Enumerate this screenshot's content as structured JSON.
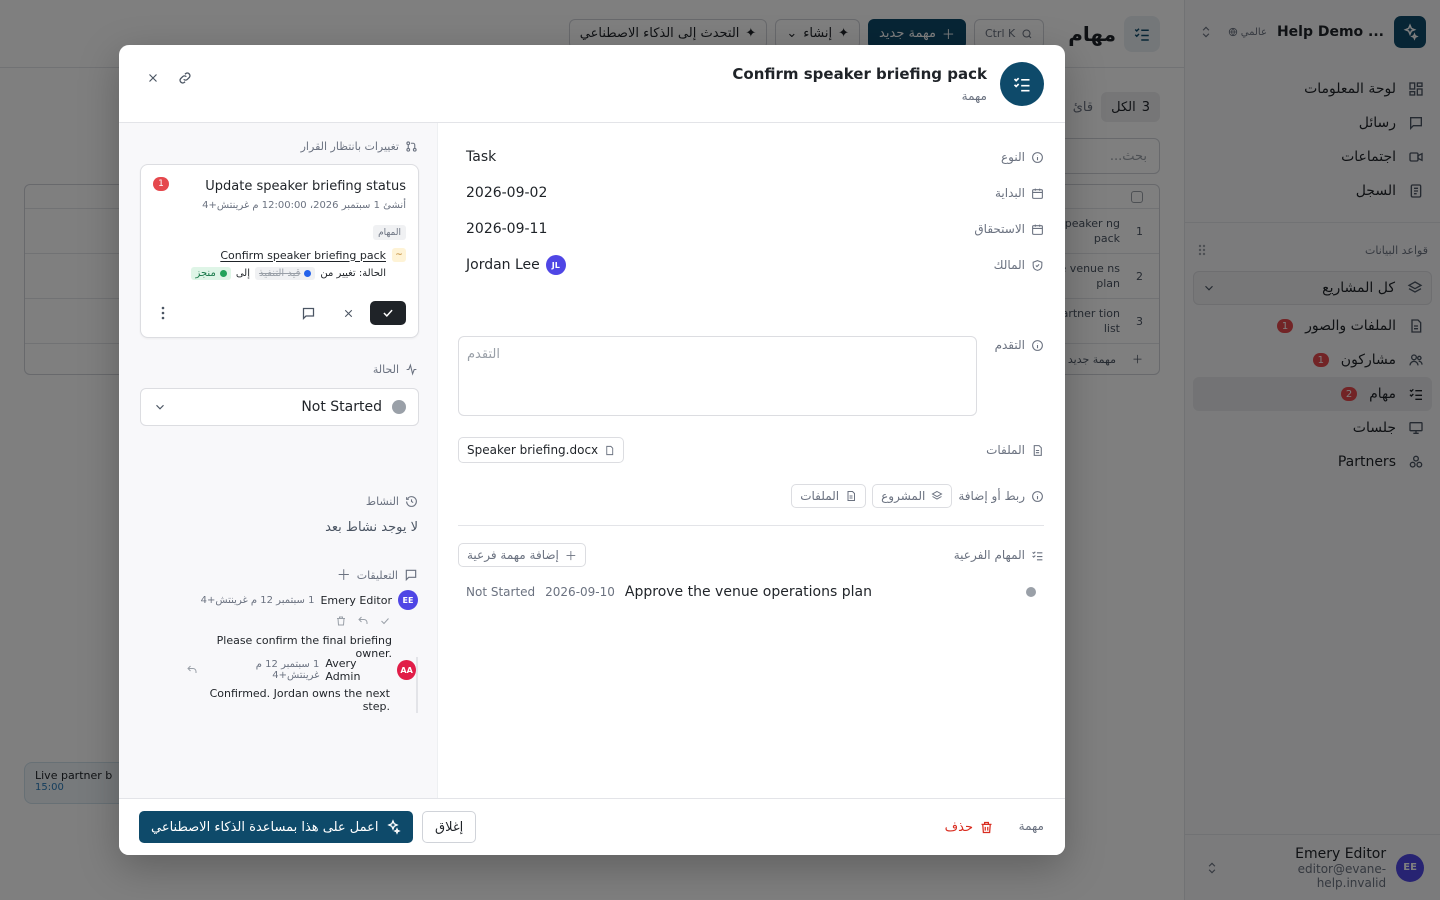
{
  "colors": {
    "brand": "#0e4a6a",
    "danger": "#d92d20",
    "badge": "#e5484d",
    "success": "#19794a",
    "avatar": "#4f46e5"
  },
  "sidebar": {
    "brand_name": "Help Demo ...",
    "brand_badge": "عالمي",
    "nav": [
      {
        "label": "لوحة المعلومات",
        "icon": "dashboard-icon"
      },
      {
        "label": "رسائل",
        "icon": "message-icon"
      },
      {
        "label": "اجتماعات",
        "icon": "video-icon"
      },
      {
        "label": "السجل",
        "icon": "log-icon"
      }
    ],
    "databases_label": "قواعد البيانات",
    "project_select": "كل المشاريع",
    "db_items": [
      {
        "label": "الملفات والصور",
        "count": "1",
        "icon": "file-icon"
      },
      {
        "label": "مشاركون",
        "count": "1",
        "icon": "users-icon"
      },
      {
        "label": "مهام",
        "count": "2",
        "icon": "tasks-icon",
        "active": true
      },
      {
        "label": "جلسات",
        "count": "",
        "icon": "presentation-icon"
      },
      {
        "label": "Partners",
        "count": "",
        "icon": "partners-icon"
      }
    ],
    "user": {
      "initials": "EE",
      "name": "Emery Editor",
      "email": "editor@evane-help.invalid"
    }
  },
  "topbar": {
    "title": "مهام",
    "search_kbd": "Ctrl K",
    "new_task": "مهمة جديد",
    "create": "إنشاء",
    "talk_ai": "التحدث إلى الذكاء الاصطناعي"
  },
  "background": {
    "tab_all": "الكل",
    "tab_all_count": "3",
    "tab_list": "قائ",
    "search_placeholder": "بحث...",
    "rows": [
      {
        "num": "1",
        "name": "speaker ng pack"
      },
      {
        "num": "2",
        "name": "e venue ns plan"
      },
      {
        "num": "3",
        "name": "partner tion list"
      }
    ],
    "new_row": "مهمة جديد",
    "card_title": "Live partner b",
    "card_time": "15:00"
  },
  "modal": {
    "title": "Confirm speaker briefing pack",
    "subtitle": "مهمة",
    "pending": {
      "label": "تغييرات بانتظار القرار",
      "title": "Update speaker briefing status",
      "badge": "1",
      "created": "أنشئ 1 سبتمبر 2026، 12:00:00 م غرينتش+4",
      "chip": "المهام",
      "link": "Confirm speaker briefing pack",
      "change_prefix": "الحالة: تغيير من",
      "from": "قيد التنفيذ",
      "to_word": "إلى",
      "to": "منجز"
    },
    "status_label": "الحالة",
    "status_value": "Not Started",
    "activity_label": "النشاط",
    "no_activity": "لا يوجد نشاط بعد",
    "comments_label": "التعليقات",
    "comments": [
      {
        "initials": "EE",
        "author": "Emery Editor",
        "time": "1 سبتمبر 12 م غرينتش+4",
        "text": "Please confirm the final briefing owner.",
        "color": "#4f46e5"
      },
      {
        "initials": "AA",
        "author": "Avery Admin",
        "time": "1 سبتمبر 12 م غرينتش+4",
        "text": "Confirmed. Jordan owns the next step.",
        "color": "#e11d48"
      }
    ],
    "fields": {
      "type_label": "النوع",
      "type_value": "Task",
      "start_label": "البداية",
      "start_value": "2026-09-02",
      "due_label": "الاستحقاق",
      "due_value": "2026-09-11",
      "owner_label": "المالك",
      "owner_value": "Jordan Lee",
      "owner_initials": "JL",
      "progress_label": "التقدم",
      "progress_placeholder": "التقدم",
      "files_label": "الملفات",
      "file_name": "Speaker briefing.docx",
      "link_label": "ربط أو إضافة",
      "link_project": "المشروع",
      "link_files": "الملفات",
      "subtasks_label": "المهام الفرعية",
      "add_subtask": "إضافة مهمة فرعية"
    },
    "subtask": {
      "status": "Not Started",
      "date": "2026-09-10",
      "name": "Approve the venue operations plan"
    },
    "footer": {
      "ai_button": "اعمل على هذا بمساعدة الذكاء الاصطناعي",
      "close_button": "إغلاق",
      "delete_button": "حذف",
      "type": "مهمة"
    }
  }
}
